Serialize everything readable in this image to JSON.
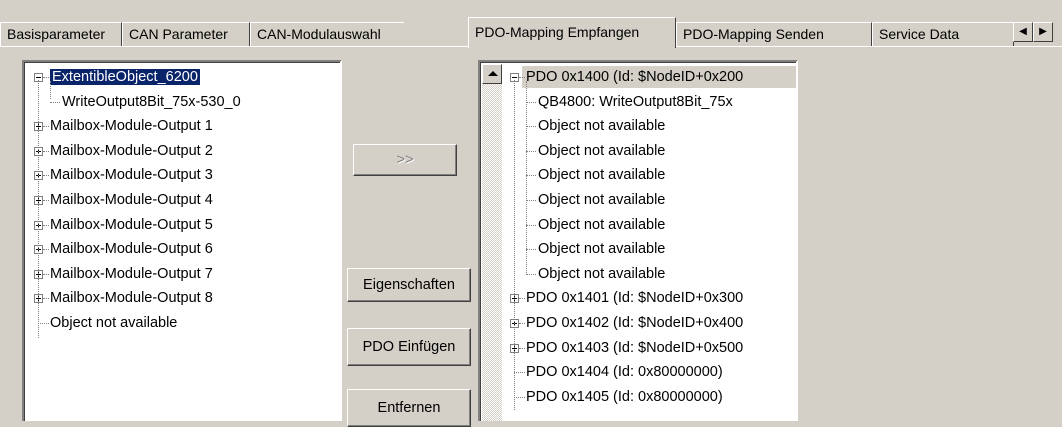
{
  "tabs": [
    {
      "label": "Basisparameter"
    },
    {
      "label": "CAN Parameter"
    },
    {
      "label": "CAN-Modulauswahl"
    },
    {
      "label": "PDO-Mapping Empfangen",
      "active": true
    },
    {
      "label": "PDO-Mapping Senden"
    },
    {
      "label": "Service Data"
    }
  ],
  "tab_scroll": {
    "left_icon": "arrow-left-icon",
    "right_icon": "arrow-right-icon"
  },
  "left_tree": {
    "items": [
      {
        "label": "ExtentibleObject_6200",
        "expander": "minus",
        "selected": true
      },
      {
        "label": "WriteOutput8Bit_75x-530_0",
        "child": true
      },
      {
        "label": "Mailbox-Module-Output 1",
        "expander": "plus"
      },
      {
        "label": "Mailbox-Module-Output 2",
        "expander": "plus"
      },
      {
        "label": "Mailbox-Module-Output 3",
        "expander": "plus"
      },
      {
        "label": "Mailbox-Module-Output 4",
        "expander": "plus"
      },
      {
        "label": "Mailbox-Module-Output 5",
        "expander": "plus"
      },
      {
        "label": "Mailbox-Module-Output 6",
        "expander": "plus"
      },
      {
        "label": "Mailbox-Module-Output 7",
        "expander": "plus"
      },
      {
        "label": "Mailbox-Module-Output 8",
        "expander": "plus"
      },
      {
        "label": "Object not available"
      }
    ]
  },
  "buttons": {
    "add": ">>",
    "properties": "Eigenschaften",
    "insert_pdo": "PDO Einfügen",
    "remove": "Entfernen"
  },
  "right_tree": {
    "items": [
      {
        "label": "PDO 0x1400 (Id: $NodeID+0x200",
        "expander": "minus",
        "highlight": true
      },
      {
        "label": "QB4800: WriteOutput8Bit_75x",
        "child": true
      },
      {
        "label": "Object not available",
        "child": true
      },
      {
        "label": "Object not available",
        "child": true
      },
      {
        "label": "Object not available",
        "child": true
      },
      {
        "label": "Object not available",
        "child": true
      },
      {
        "label": "Object not available",
        "child": true
      },
      {
        "label": "Object not available",
        "child": true
      },
      {
        "label": "Object not available",
        "child": true
      },
      {
        "label": "PDO 0x1401 (Id: $NodeID+0x300",
        "expander": "plus"
      },
      {
        "label": "PDO 0x1402 (Id: $NodeID+0x400",
        "expander": "plus"
      },
      {
        "label": "PDO 0x1403 (Id: $NodeID+0x500",
        "expander": "plus"
      },
      {
        "label": "PDO 0x1404 (Id: 0x80000000)"
      },
      {
        "label": "PDO 0x1405 (Id: 0x80000000)"
      }
    ]
  }
}
